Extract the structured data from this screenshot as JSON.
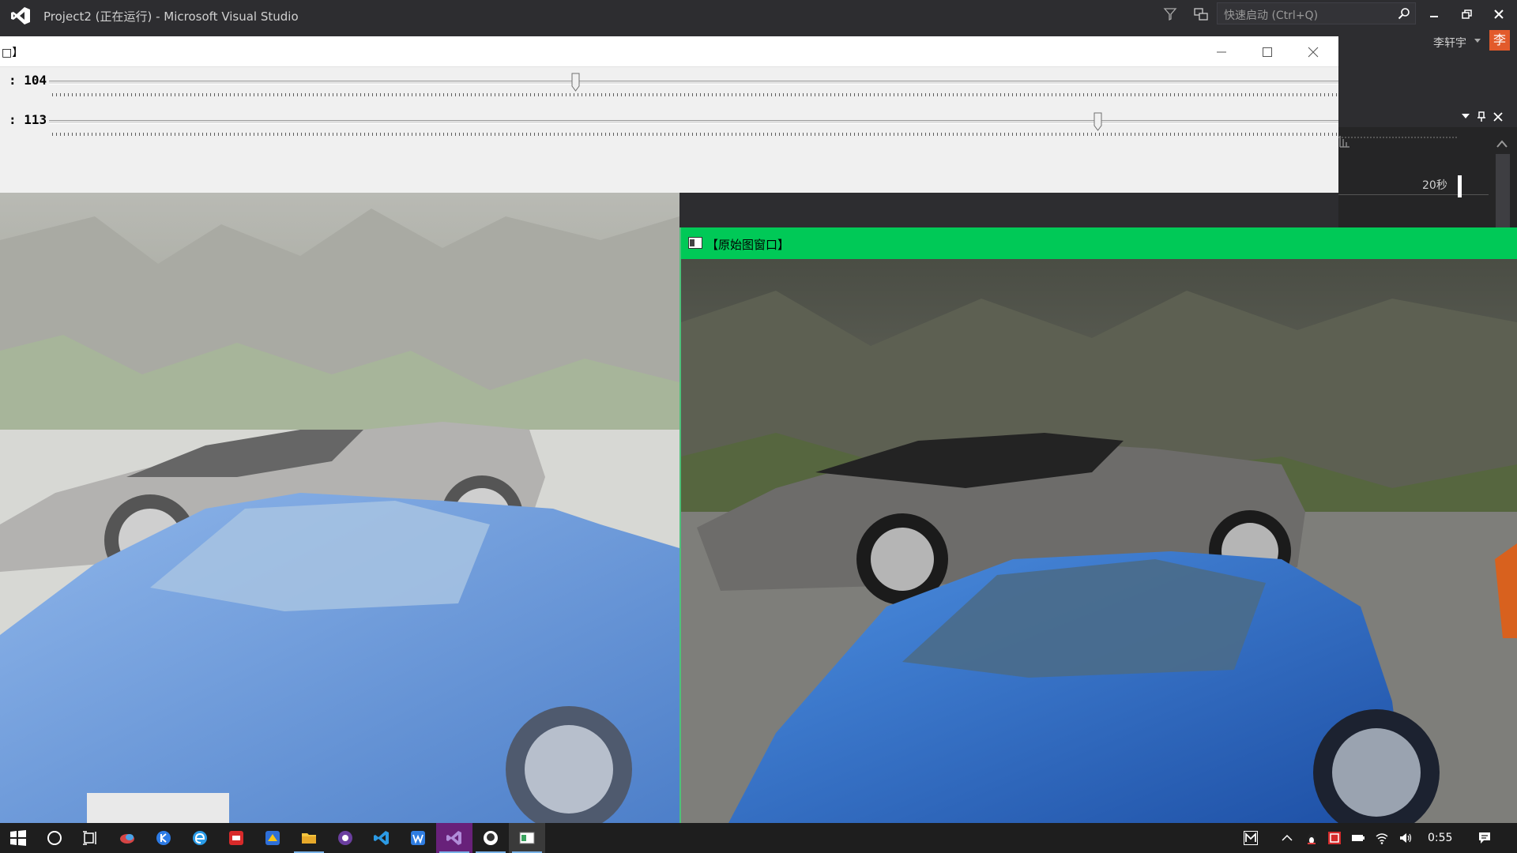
{
  "vs": {
    "title": "Project2 (正在运行) - Microsoft Visual Studio",
    "quick_launch_placeholder": "快速启动 (Ctrl+Q)",
    "user_name": "李轩宇",
    "user_avatar_text": "李",
    "timeline_label": "20秒",
    "accent_color": "#68217a"
  },
  "trackbar_window": {
    "title": "□】",
    "sliders": [
      {
        "label": ": 104",
        "value": 104,
        "max": 255
      },
      {
        "label": ": 113",
        "value": 113,
        "max": 139
      }
    ]
  },
  "original_window": {
    "title": "【原始图窗口】",
    "titlebar_color": "#00c957"
  },
  "taskbar": {
    "clock": "0:55",
    "apps": [
      "start-icon",
      "cortana-icon",
      "task-view-icon",
      "bird-app-icon",
      "k-app-icon",
      "edge-icon",
      "red-app-icon",
      "yellow-app-icon",
      "file-explorer-icon",
      "purple-app-icon",
      "vscode-icon",
      "wps-icon",
      "visual-studio-icon",
      "github-icon",
      "opencv-window-icon"
    ],
    "tray": [
      "m-icon",
      "chevron-up-icon",
      "penguin-icon",
      "security-icon",
      "battery-icon",
      "wifi-icon",
      "volume-icon",
      "notification-icon"
    ]
  }
}
